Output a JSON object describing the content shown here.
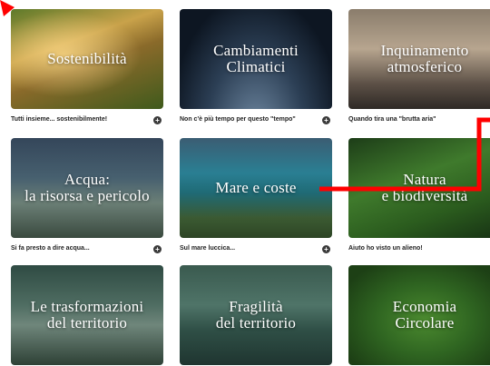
{
  "cards": [
    {
      "title": "Sostenibilità",
      "caption": "Tutti insieme... sostenibilmente!",
      "plus": "+"
    },
    {
      "title": "Cambiamenti\nClimatici",
      "caption": "Non c'è più tempo per questo \"tempo\"",
      "plus": "+"
    },
    {
      "title": "Inquinamento\natmosferico",
      "caption": "Quando tira una \"brutta aria\"",
      "plus": "+"
    },
    {
      "title": "Acqua:\nla risorsa e pericolo",
      "caption": "Si fa presto a dire acqua...",
      "plus": "+"
    },
    {
      "title": "Mare e coste",
      "caption": "Sul mare luccica...",
      "plus": "+"
    },
    {
      "title": "Natura\ne biodiversità",
      "caption": "Aiuto ho visto un alieno!",
      "plus": "+"
    },
    {
      "title": "Le trasformazioni\ndel territorio",
      "caption": "",
      "plus": ""
    },
    {
      "title": "Fragilità\ndel territorio",
      "caption": "",
      "plus": ""
    },
    {
      "title": "Economia\nCircolare",
      "caption": "",
      "plus": ""
    }
  ],
  "colors": {
    "overlay_marker": "#ff0000"
  }
}
